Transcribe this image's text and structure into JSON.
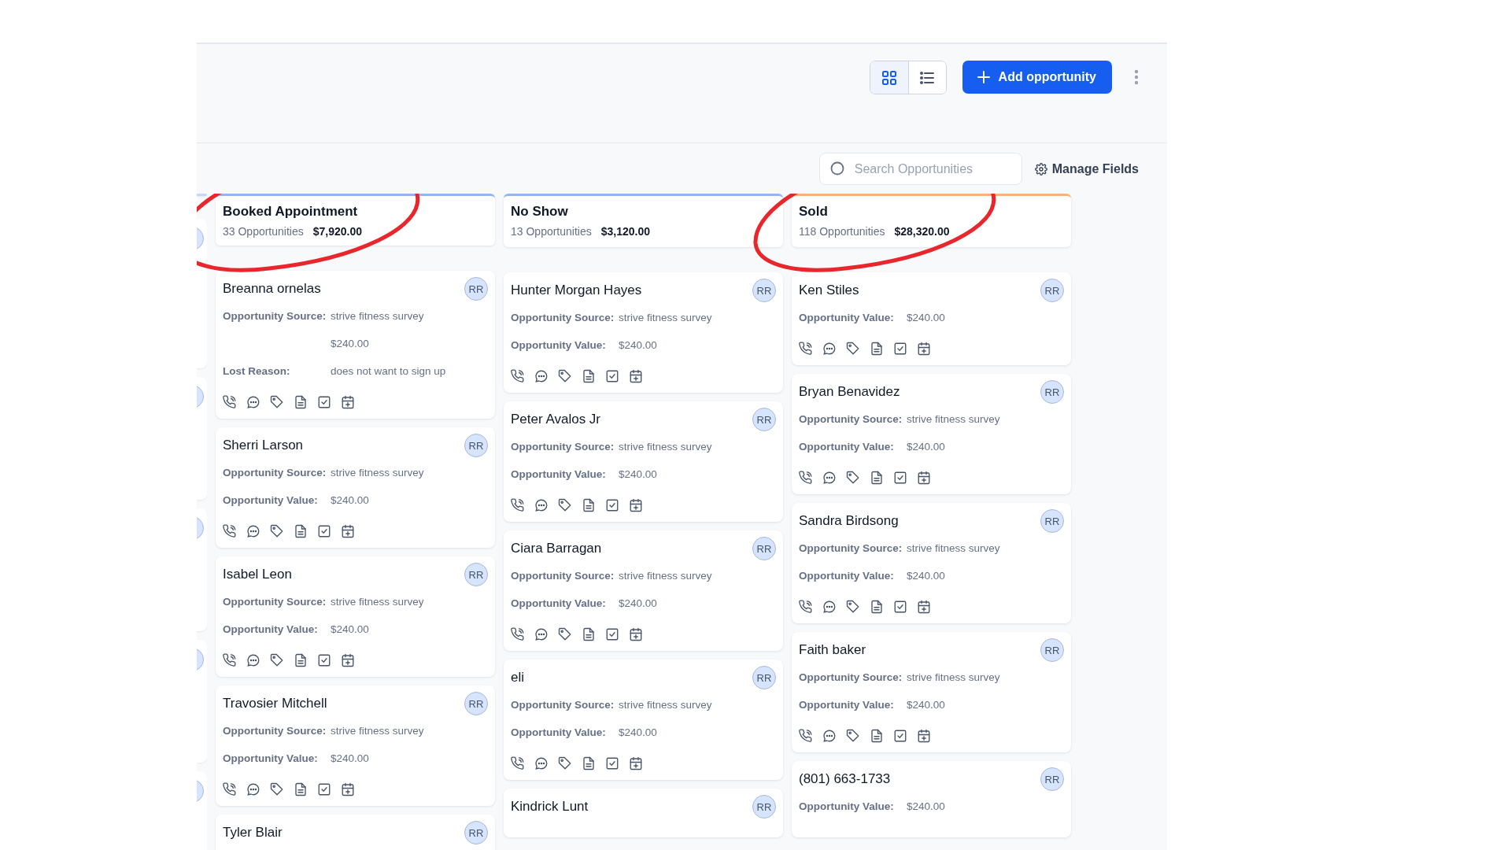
{
  "toolbar": {
    "views": [
      {
        "kind": "grid",
        "selected": true
      },
      {
        "kind": "list",
        "selected": false
      }
    ],
    "add_button": "Add opportunity"
  },
  "filters": {
    "search": {
      "placeholder": "Search Opportunities"
    },
    "manage_fields": "Manage Fields"
  },
  "columns": [
    {
      "title": "Booked Appointment",
      "count": "33 Opportunities",
      "total": "$7,920.00",
      "color": "#93b4f5",
      "circled": true,
      "cards": [
        {
          "name": "Breanna ornelas",
          "avatar": "RR",
          "fields": [
            {
              "label": "Opportunity Source:",
              "value": "strive fitness survey"
            },
            {
              "value": "$240.00"
            },
            {
              "label": "Lost Reason:",
              "value": "does not want to sign up"
            }
          ],
          "actions": true
        },
        {
          "name": "Sherri Larson",
          "avatar": "RR",
          "fields": [
            {
              "label": "Opportunity Source:",
              "value": "strive fitness survey"
            },
            {
              "label": "Opportunity Value:",
              "value": "$240.00"
            }
          ],
          "actions": true
        },
        {
          "name": "Isabel Leon",
          "avatar": "RR",
          "fields": [
            {
              "label": "Opportunity Source:",
              "value": "strive fitness survey"
            },
            {
              "label": "Opportunity Value:",
              "value": "$240.00"
            }
          ],
          "actions": true
        },
        {
          "name": "Travosier Mitchell",
          "avatar": "RR",
          "fields": [
            {
              "label": "Opportunity Source:",
              "value": "strive fitness survey"
            },
            {
              "label": "Opportunity Value:",
              "value": "$240.00"
            }
          ],
          "actions": true
        },
        {
          "name": "Tyler Blair",
          "avatar": "RR",
          "actions": false
        }
      ]
    },
    {
      "title": "No Show",
      "count": "13 Opportunities",
      "total": "$3,120.00",
      "color": "#93b4f5",
      "circled": false,
      "cards": [
        {
          "name": "Hunter Morgan Hayes",
          "avatar": "RR",
          "fields": [
            {
              "label": "Opportunity Source:",
              "value": "strive fitness survey"
            },
            {
              "label": "Opportunity Value:",
              "value": "$240.00"
            }
          ],
          "actions": true
        },
        {
          "name": "Peter Avalos Jr",
          "avatar": "RR",
          "fields": [
            {
              "label": "Opportunity Source:",
              "value": "strive fitness survey"
            },
            {
              "label": "Opportunity Value:",
              "value": "$240.00"
            }
          ],
          "actions": true
        },
        {
          "name": "Ciara Barragan",
          "avatar": "RR",
          "fields": [
            {
              "label": "Opportunity Source:",
              "value": "strive fitness survey"
            },
            {
              "label": "Opportunity Value:",
              "value": "$240.00"
            }
          ],
          "actions": true
        },
        {
          "name": "eli",
          "avatar": "RR",
          "fields": [
            {
              "label": "Opportunity Source:",
              "value": "strive fitness survey"
            },
            {
              "label": "Opportunity Value:",
              "value": "$240.00"
            }
          ],
          "actions": true
        },
        {
          "name": "Kindrick Lunt",
          "avatar": "RR",
          "actions": false
        }
      ]
    },
    {
      "title": "Sold",
      "count": "118 Opportunities",
      "total": "$28,320.00",
      "color": "#f8b27a",
      "circled": true,
      "cards": [
        {
          "name": "Ken Stiles",
          "avatar": "RR",
          "fields": [
            {
              "label": "Opportunity Value:",
              "value": "$240.00"
            }
          ],
          "actions": true
        },
        {
          "name": "Bryan Benavidez",
          "avatar": "RR",
          "fields": [
            {
              "label": "Opportunity Source:",
              "value": "strive fitness survey"
            },
            {
              "label": "Opportunity Value:",
              "value": "$240.00"
            }
          ],
          "actions": true
        },
        {
          "name": "Sandra Birdsong",
          "avatar": "RR",
          "fields": [
            {
              "label": "Opportunity Source:",
              "value": "strive fitness survey"
            },
            {
              "label": "Opportunity Value:",
              "value": "$240.00"
            }
          ],
          "actions": true
        },
        {
          "name": "Faith baker",
          "avatar": "RR",
          "fields": [
            {
              "label": "Opportunity Source:",
              "value": "strive fitness survey"
            },
            {
              "label": "Opportunity Value:",
              "value": "$240.00"
            }
          ],
          "actions": true
        },
        {
          "name": "(801) 663-1733",
          "avatar": "RR",
          "fields": [
            {
              "label": "Opportunity Value:",
              "value": "$240.00"
            }
          ],
          "actions": false
        }
      ]
    }
  ]
}
